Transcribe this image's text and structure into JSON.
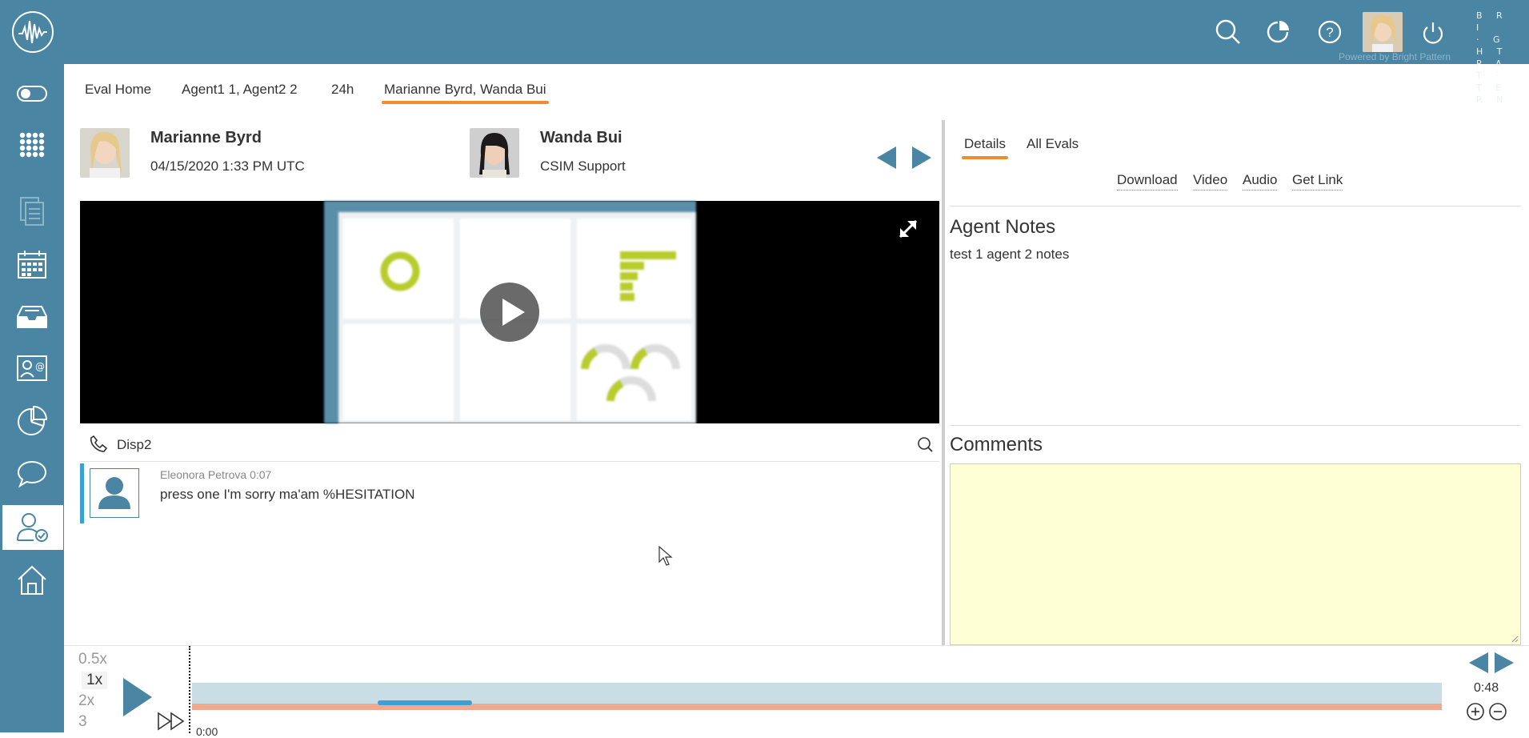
{
  "brand": {
    "logo_letters": "BRIGHTPATTERN",
    "lines": [
      "B R I",
      "· G H T",
      "P A T ·",
      "T E R N"
    ],
    "powered": "Powered by Bright Pattern"
  },
  "colors": {
    "primary": "#4a85a3",
    "accent": "#f28b30",
    "comments_bg": "#ffffd6",
    "timeline_bg": "#c9dde6",
    "timeline_red": "#f0a98f",
    "timeline_blue": "#3ba0d6"
  },
  "topbar_icons": [
    "search-icon",
    "pie-refresh-icon",
    "help-icon",
    "user-avatar",
    "power-icon"
  ],
  "sidebar_icons": [
    "toggle-icon",
    "grid-icon",
    "documents-icon",
    "calendar-icon",
    "tray-icon",
    "contact-card-icon",
    "pie-chart-icon",
    "chat-bubble-icon",
    "user-check-icon",
    "home-icon"
  ],
  "tabs": [
    {
      "label": "Eval Home"
    },
    {
      "label": "Agent1 1, Agent2 2"
    },
    {
      "label": "24h"
    },
    {
      "label": "Marianne Byrd, Wanda Bui"
    }
  ],
  "person1": {
    "name": "Marianne Byrd",
    "sub": "04/15/2020 1:33 PM UTC"
  },
  "person2": {
    "name": "Wanda Bui",
    "sub": "CSIM Support"
  },
  "disposition": "Disp2",
  "transcript": [
    {
      "speaker": "Eleonora Petrova 0:07",
      "text": "press one I'm sorry ma'am %HESITATION"
    }
  ],
  "right": {
    "tabs": [
      "Details",
      "All Evals"
    ],
    "links": [
      "Download",
      "Video",
      "Audio",
      "Get Link"
    ],
    "agent_notes_title": "Agent Notes",
    "agent_notes": "test 1 agent 2 notes",
    "comments_title": "Comments"
  },
  "player": {
    "speeds": [
      "0.5x",
      "1x",
      "2x",
      "3"
    ],
    "selected_speed": "1x",
    "time_current": "0:00",
    "time_total": "0:48"
  }
}
